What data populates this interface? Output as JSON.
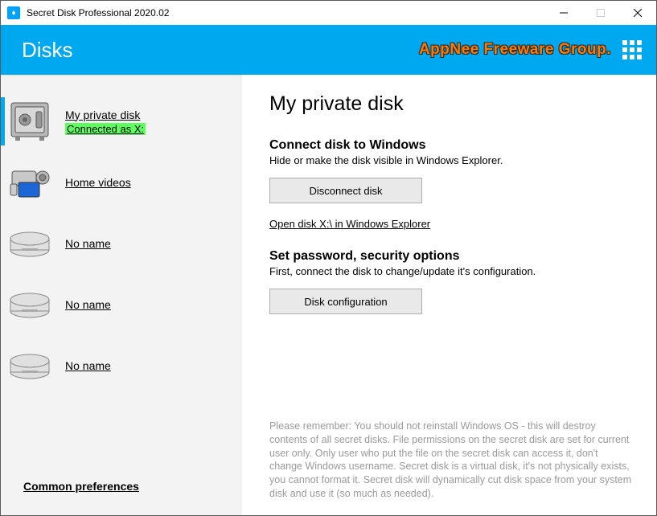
{
  "window": {
    "title": "Secret Disk Professional 2020.02"
  },
  "header": {
    "title": "Disks",
    "brand": "AppNee Freeware Group."
  },
  "sidebar": {
    "items": [
      {
        "name": "My private disk",
        "status": "Connected as X:",
        "selected": true,
        "icon": "safe"
      },
      {
        "name": "Home videos",
        "status": "",
        "selected": false,
        "icon": "camcorder"
      },
      {
        "name": "No name",
        "status": "",
        "selected": false,
        "icon": "harddisk"
      },
      {
        "name": "No name",
        "status": "",
        "selected": false,
        "icon": "harddisk"
      },
      {
        "name": "No name",
        "status": "",
        "selected": false,
        "icon": "harddisk"
      }
    ],
    "common_prefs": "Common preferences"
  },
  "content": {
    "page_title": "My private disk",
    "section1_title": "Connect disk to Windows",
    "section1_sub": "Hide or make the disk visible in Windows Explorer.",
    "disconnect_btn": "Disconnect disk",
    "open_link": "Open disk X:\\ in Windows Explorer",
    "section2_title": "Set password, security options",
    "section2_sub": "First, connect the disk to change/update it's configuration.",
    "config_btn": "Disk configuration",
    "notice": "Please remember: You should not reinstall Windows OS - this will destroy contents of all secret disks. File permissions on the secret disk are set for current user only. Only user who put the file on the secret disk can access it, don't change Windows username. Secret disk is a virtual disk, it's not physically exists, you cannot format it. Secret disk will dynamically cut disk space from your system disk and use it (so much as needed)."
  }
}
